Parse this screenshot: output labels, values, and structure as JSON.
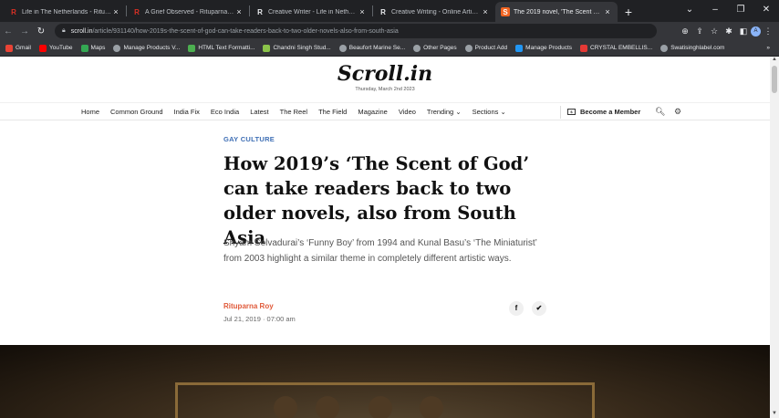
{
  "browser": {
    "tabs": [
      {
        "title": "Life in The Netherlands - Rituparna",
        "favicon": "R",
        "active": false
      },
      {
        "title": "A Grief Observed - Rituparna Roy",
        "favicon": "R",
        "active": false
      },
      {
        "title": "Creative Writer - Life in Netherlands",
        "favicon": "R",
        "active": false
      },
      {
        "title": "Creative Writing - Online Articles",
        "favicon": "R",
        "active": false
      },
      {
        "title": "The 2019 novel, 'The Scent of God'",
        "favicon": "S",
        "active": true
      }
    ],
    "new_tab": "+",
    "url_host": "scroll.in",
    "url_path": "/article/931140/how-2019s-the-scent-of-god-can-take-readers-back-to-two-older-novels-also-from-south-asia",
    "profile_initial": "A",
    "bookmarks": [
      {
        "label": "Gmail",
        "color": "#ea4335"
      },
      {
        "label": "YouTube",
        "color": "#ff0000"
      },
      {
        "label": "Maps",
        "color": "#34a853"
      },
      {
        "label": "Manage Products V...",
        "color": "#9aa0a6"
      },
      {
        "label": "HTML Text Formatti...",
        "color": "#4caf50"
      },
      {
        "label": "Chandni Singh Stud...",
        "color": "#8bc34a"
      },
      {
        "label": "Beaufort Marine Se...",
        "color": "#9aa0a6"
      },
      {
        "label": "Other Pages",
        "color": "#9aa0a6"
      },
      {
        "label": "Product Add",
        "color": "#9aa0a6"
      },
      {
        "label": "Manage Products",
        "color": "#2196f3"
      },
      {
        "label": "CRYSTAL EMBELLIS...",
        "color": "#e53935"
      },
      {
        "label": "Swatisinghlabel.com",
        "color": "#9aa0a6"
      }
    ],
    "bookmarks_more": "»"
  },
  "site": {
    "logo": "Scroll.in",
    "date": "Thursday, March 2nd 2023",
    "nav": [
      "Home",
      "Common Ground",
      "India Fix",
      "Eco India",
      "Latest",
      "The Reel",
      "The Field",
      "Magazine",
      "Video",
      "Trending ⌄",
      "Sections ⌄"
    ],
    "member_label": "Become a Member"
  },
  "article": {
    "category": "GAY CULTURE",
    "headline": "How 2019’s ‘The Scent of God’ can take readers back to two older novels, also from South Asia",
    "standfirst": "Shyam Selvadurai’s ‘Funny Boy’ from 1994 and Kunal Basu’s ‘The Miniaturist’ from 2003 highlight a similar theme in completely different artistic ways.",
    "author": "Rituparna Roy",
    "published": "Jul 21, 2019 · 07:00 am",
    "share_icons": [
      "facebook-icon",
      "twitter-icon"
    ]
  },
  "colors": {
    "category": "#3f6fb5",
    "author": "#e05a3a"
  }
}
